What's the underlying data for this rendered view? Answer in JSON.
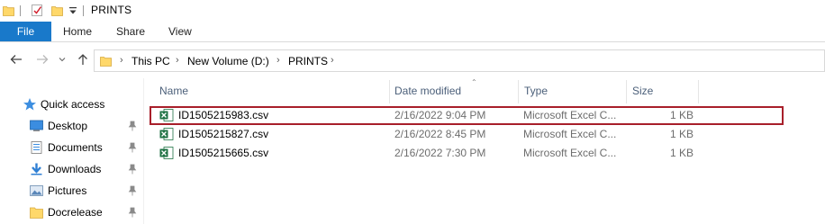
{
  "window": {
    "title": "PRINTS"
  },
  "ribbon": {
    "tabs": [
      "File",
      "Home",
      "Share",
      "View"
    ]
  },
  "address_bar": {
    "crumbs": [
      "This PC",
      "New Volume (D:)",
      "PRINTS"
    ]
  },
  "nav_pane": {
    "quick_access_label": "Quick access",
    "items": [
      {
        "label": "Desktop",
        "icon": "desktop-icon"
      },
      {
        "label": "Documents",
        "icon": "documents-icon"
      },
      {
        "label": "Downloads",
        "icon": "downloads-icon"
      },
      {
        "label": "Pictures",
        "icon": "pictures-icon"
      },
      {
        "label": "Docrelease",
        "icon": "folder-icon"
      }
    ]
  },
  "file_list": {
    "columns": {
      "name": "Name",
      "date": "Date modified",
      "type": "Type",
      "size": "Size"
    },
    "rows": [
      {
        "name": "ID1505215983.csv",
        "date": "2/16/2022 9:04 PM",
        "type": "Microsoft Excel C...",
        "size": "1 KB",
        "selected": true
      },
      {
        "name": "ID1505215827.csv",
        "date": "2/16/2022 8:45 PM",
        "type": "Microsoft Excel C...",
        "size": "1 KB",
        "selected": false
      },
      {
        "name": "ID1505215665.csv",
        "date": "2/16/2022 7:30 PM",
        "type": "Microsoft Excel C...",
        "size": "1 KB",
        "selected": false
      }
    ]
  },
  "colors": {
    "accent": "#1979ca",
    "selection_outline": "#a81f2a",
    "excel_green": "#1f7244",
    "folder_yellow": "#ffd86a"
  }
}
